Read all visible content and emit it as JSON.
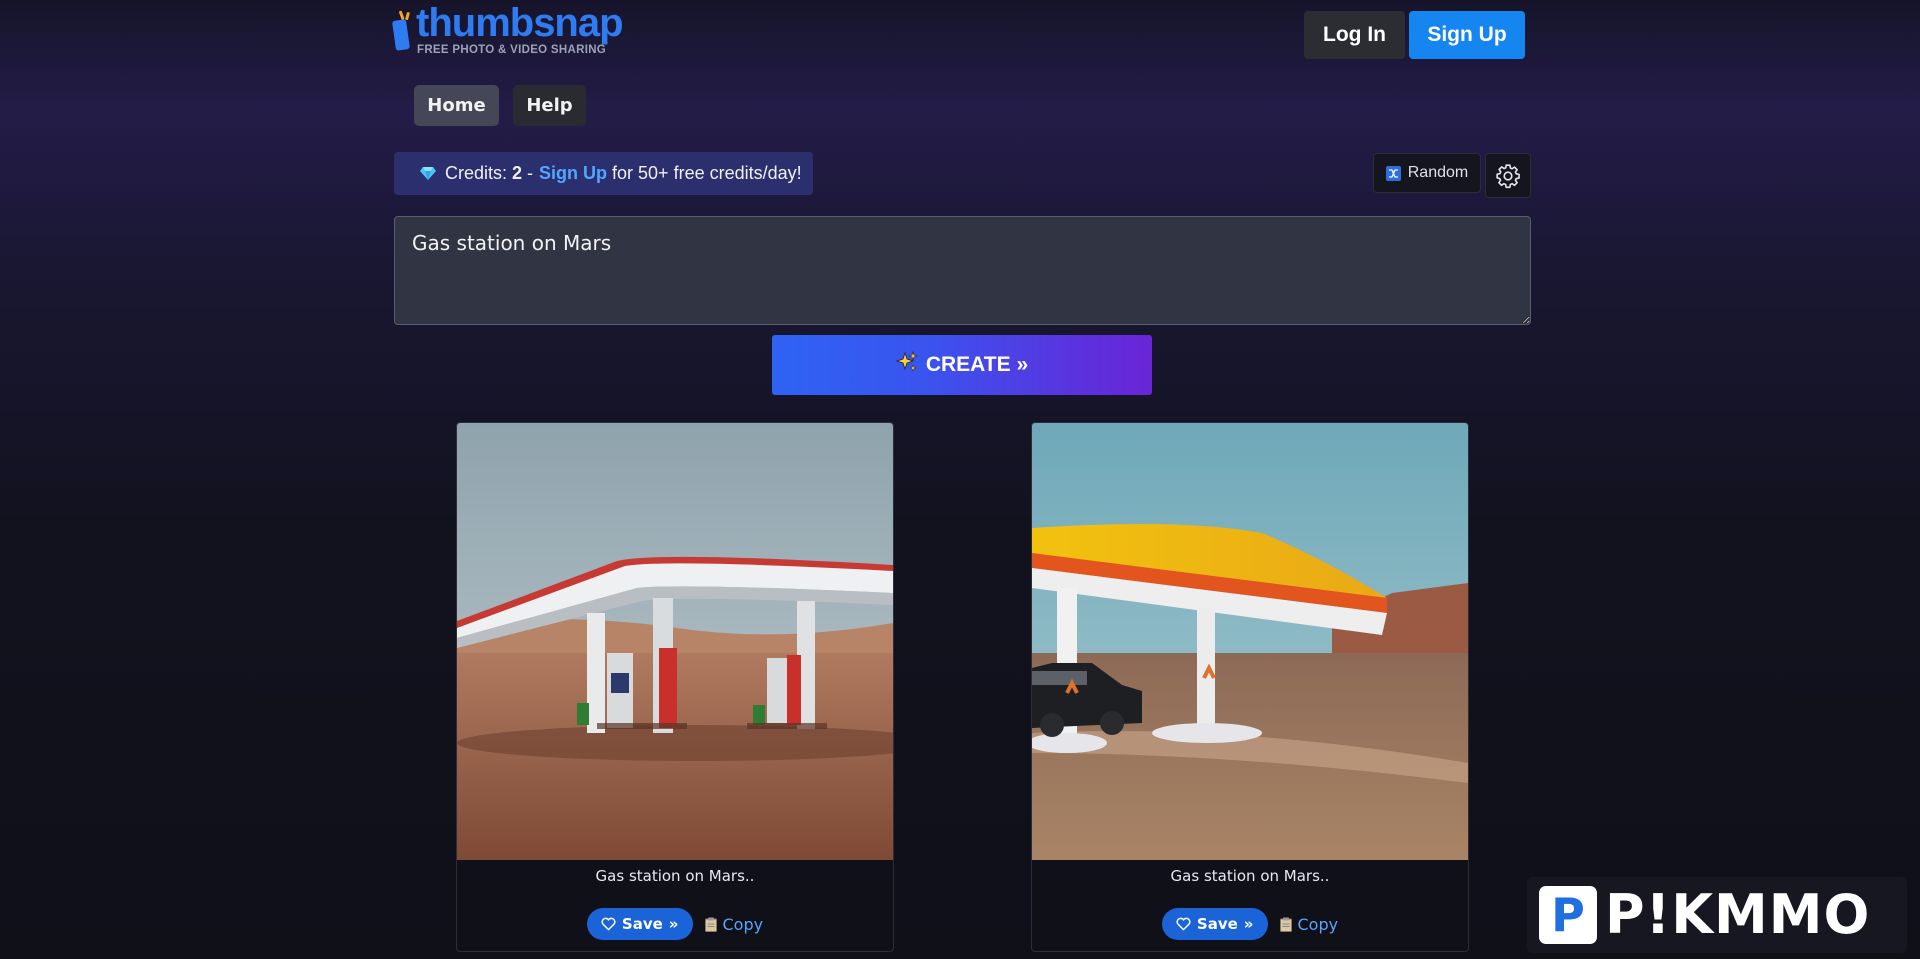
{
  "brand": {
    "name": "thumbsnap",
    "tagline": "FREE PHOTO & VIDEO SHARING"
  },
  "header": {
    "login_label": "Log In",
    "signup_label": "Sign Up"
  },
  "nav": {
    "items": [
      {
        "label": "Home",
        "active": true
      },
      {
        "label": "Help",
        "active": false
      }
    ]
  },
  "credits": {
    "label": "Credits:",
    "count": "2",
    "separator": "-",
    "signup_link": "Sign Up",
    "suffix": "for 50+ free credits/day!",
    "icon": "gem-icon"
  },
  "toolbar": {
    "random_label": "Random",
    "random_icon": "shuffle-icon",
    "settings_icon": "gear-icon"
  },
  "prompt": {
    "value": "Gas station on Mars"
  },
  "create": {
    "icon": "sparkles-icon",
    "label": "CREATE »"
  },
  "results": [
    {
      "caption": "Gas station on Mars..",
      "save_label": "Save",
      "save_suffix": "»",
      "copy_label": "Copy"
    },
    {
      "caption": "Gas station on Mars..",
      "save_label": "Save",
      "save_suffix": "»",
      "copy_label": "Copy"
    }
  ],
  "watermark": {
    "letter": "P",
    "text": "P!KMMO"
  },
  "colors": {
    "accent_blue": "#1585f0",
    "create_gradient_start": "#2e63f3",
    "create_gradient_end": "#6a25d6",
    "credits_bg": "#2b2f6d",
    "link": "#52a6ff"
  }
}
